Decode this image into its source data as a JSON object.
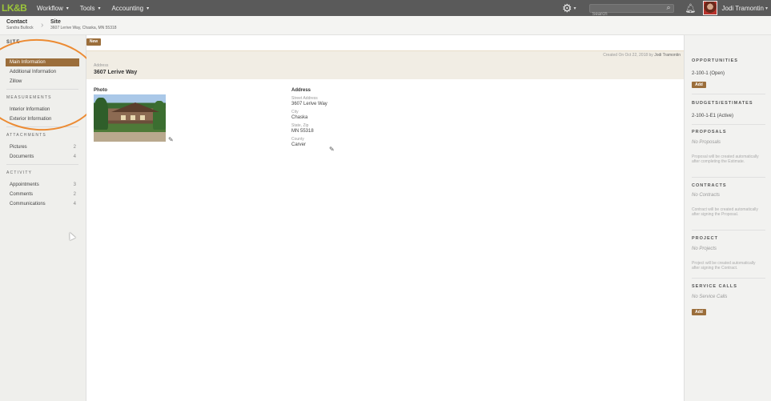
{
  "topbar": {
    "logo": "LK&B",
    "menu": [
      {
        "label": "Workflow"
      },
      {
        "label": "Tools"
      },
      {
        "label": "Accounting"
      }
    ],
    "search_placeholder": "Search",
    "user_name": "Jodi Tramontin",
    "caret": "▾"
  },
  "breadcrumb": {
    "contact_title": "Contact",
    "contact_sub": "Sandra Bullock",
    "site_title": "Site",
    "site_sub": "3607 Lerive Way, Chaska, MN 55318"
  },
  "sidebar": {
    "title": "SITE",
    "main_items": [
      "Main Information",
      "Additional Information",
      "Zillow"
    ],
    "measurements_head": "MEASUREMENTS",
    "measurements": [
      "Interior Information",
      "Exterior Information"
    ],
    "attachments_head": "ATTACHMENTS",
    "attachments": [
      {
        "label": "Pictures",
        "count": "2"
      },
      {
        "label": "Documents",
        "count": "4"
      }
    ],
    "activity_head": "ACTIVITY",
    "activity": [
      {
        "label": "Appointments",
        "count": "3"
      },
      {
        "label": "Comments",
        "count": "2"
      },
      {
        "label": "Communications",
        "count": "4"
      }
    ]
  },
  "main": {
    "new_label": "New",
    "created_prefix": "Created On Oct 22, 2018 by",
    "created_by": "Jodi Tramontin",
    "address_label": "Address",
    "address_value": "3607 Lerive Way",
    "photo_label": "Photo",
    "address_col": {
      "heading": "Address",
      "fields": [
        {
          "label": "Street Address",
          "value": "3607 Lerive Way"
        },
        {
          "label": "City",
          "value": "Chaska"
        },
        {
          "label": "State, Zip",
          "value": "MN 55318"
        },
        {
          "label": "County",
          "value": "Carver"
        }
      ]
    }
  },
  "rightpanel": {
    "opportunities": {
      "head": "OPPORTUNITIES",
      "link": "2-100-1 (Open)",
      "add": "Add"
    },
    "budgets": {
      "head": "BUDGETS/ESTIMATES",
      "link": "2-100-1-E1 (Active)"
    },
    "proposals": {
      "head": "PROPOSALS",
      "empty": "No Proposals",
      "note": "Proposal will be created automatically after completing the Estimate."
    },
    "contracts": {
      "head": "CONTRACTS",
      "empty": "No Contracts",
      "note": "Contract will be created automatically after signing the Proposal."
    },
    "project": {
      "head": "PROJECT",
      "empty": "No Projects",
      "note": "Project will be created automatically after signing the Contract."
    },
    "service_calls": {
      "head": "SERVICE CALLS",
      "empty": "No Service Calls",
      "add": "Add"
    }
  }
}
